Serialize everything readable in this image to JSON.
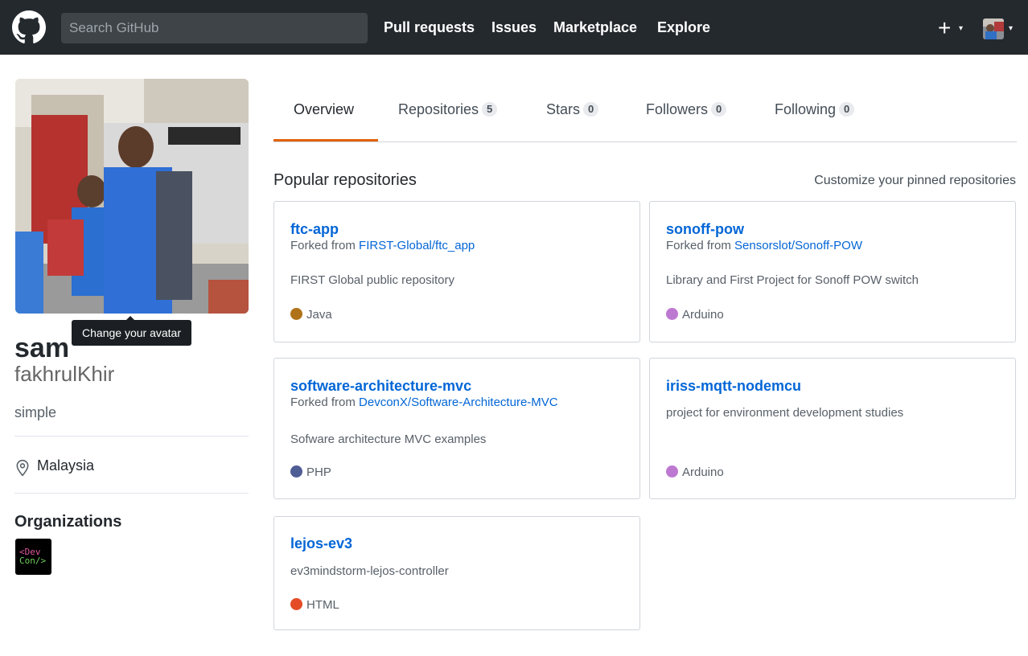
{
  "header": {
    "search_placeholder": "Search GitHub",
    "nav": [
      "Pull requests",
      "Issues",
      "Marketplace",
      "Explore"
    ],
    "plus_glyph": "+",
    "caret_glyph": "▾"
  },
  "profile": {
    "tooltip": "Change your avatar",
    "name": "sam",
    "username": "fakhrulKhir",
    "bio": "simple",
    "location": "Malaysia",
    "organizations_title": "Organizations",
    "org_avatar_text": [
      "<Dev",
      "Con/>"
    ]
  },
  "tabs": [
    {
      "label": "Overview",
      "count": null
    },
    {
      "label": "Repositories",
      "count": "5"
    },
    {
      "label": "Stars",
      "count": "0"
    },
    {
      "label": "Followers",
      "count": "0"
    },
    {
      "label": "Following",
      "count": "0"
    }
  ],
  "popular": {
    "title": "Popular repositories",
    "customize": "Customize your pinned repositories"
  },
  "repos": [
    {
      "name": "ftc-app",
      "forked_prefix": "Forked from ",
      "forked_from": "FIRST-Global/ftc_app",
      "description": "FIRST Global public repository",
      "language": "Java",
      "color": "#b07219"
    },
    {
      "name": "sonoff-pow",
      "forked_prefix": "Forked from ",
      "forked_from": "Sensorslot/Sonoff-POW",
      "description": "Library and First Project for Sonoff POW switch",
      "language": "Arduino",
      "color": "#bd79d1"
    },
    {
      "name": "software-architecture-mvc",
      "forked_prefix": "Forked from ",
      "forked_from": "DevconX/Software-Architecture-MVC",
      "description": "Sofware architecture MVC examples",
      "language": "PHP",
      "color": "#4F5D95"
    },
    {
      "name": "iriss-mqtt-nodemcu",
      "forked_prefix": "",
      "forked_from": "",
      "description": "project for environment development studies",
      "language": "Arduino",
      "color": "#bd79d1"
    },
    {
      "name": "lejos-ev3",
      "forked_prefix": "",
      "forked_from": "",
      "description": "ev3mindstorm-lejos-controller",
      "language": "HTML",
      "color": "#e34c26"
    }
  ]
}
